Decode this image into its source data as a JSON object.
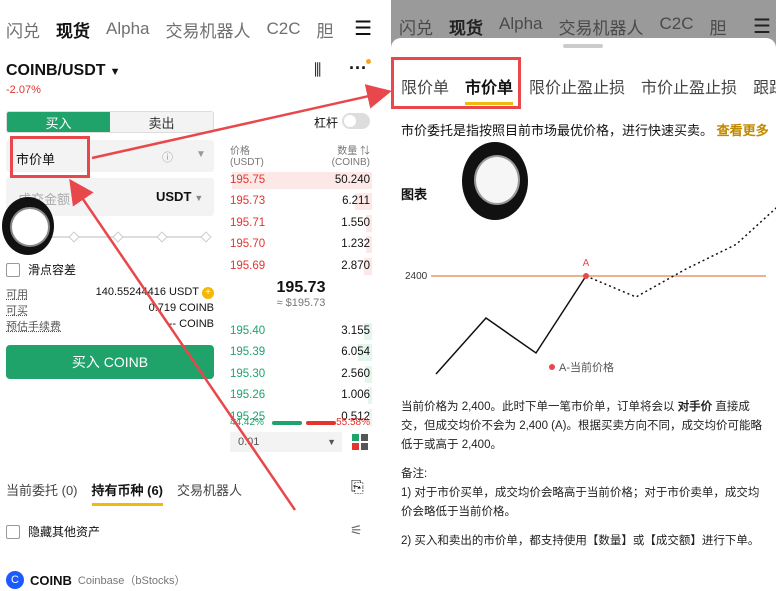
{
  "colors": {
    "buy_green": "#1fa36b",
    "sell_red": "#e3342f",
    "accent_yellow": "#f0b90b",
    "annotation_red": "#e8474b"
  },
  "nav": {
    "items": [
      "闪兑",
      "现货",
      "Alpha",
      "交易机器人",
      "C2C",
      "胆"
    ],
    "active": "现货",
    "menu_icon": "hamburger-icon"
  },
  "pair": {
    "symbol": "COINB/USDT",
    "change": "-2.07%"
  },
  "trade": {
    "buy_tab": "买入",
    "sell_tab": "卖出",
    "leverage_label": "杠杆",
    "order_type": "市价单",
    "amount_placeholder": "成交金额",
    "amount_unit": "USDT",
    "slippage_label": "滑点容差",
    "available_label": "可用",
    "available_value": "140.55244416 USDT",
    "can_buy_label": "可买",
    "can_buy_value": "0.719 COINB",
    "fee_label": "预估手续费",
    "fee_value": "-- COINB",
    "buy_button": "买入 COINB"
  },
  "orderbook": {
    "price_header": "价格\n(USDT)",
    "qty_header": "数量 ⇅\n(COINB)",
    "asks": [
      {
        "price": "195.75",
        "qty": "50.240",
        "depth": 1.0
      },
      {
        "price": "195.73",
        "qty": "6.211",
        "depth": 0.12
      },
      {
        "price": "195.71",
        "qty": "1.550",
        "depth": 0.04
      },
      {
        "price": "195.70",
        "qty": "1.232",
        "depth": 0.04
      },
      {
        "price": "195.69",
        "qty": "2.870",
        "depth": 0.06
      }
    ],
    "mid_price": "195.73",
    "mid_usd": "≈ $195.73",
    "bids": [
      {
        "price": "195.40",
        "qty": "3.155",
        "depth": 0.06
      },
      {
        "price": "195.39",
        "qty": "6.054",
        "depth": 0.1
      },
      {
        "price": "195.30",
        "qty": "2.560",
        "depth": 0.05
      },
      {
        "price": "195.26",
        "qty": "1.006",
        "depth": 0.03
      },
      {
        "price": "195.25",
        "qty": "0.512",
        "depth": 0.02
      }
    ],
    "buy_ratio": "44.42%",
    "sell_ratio": "55.58%",
    "precision": "0.01"
  },
  "bottom_tabs": {
    "items": [
      "当前委托 (0)",
      "持有币种 (6)",
      "交易机器人"
    ],
    "active": "持有币种 (6)"
  },
  "hide_assets_label": "隐藏其他资产",
  "asset": {
    "symbol": "COINB",
    "name": "Coinbase（bStocks）"
  },
  "sheet": {
    "tabs": [
      "限价单",
      "市价单",
      "限价止盈止损",
      "市价止盈止损",
      "跟踪"
    ],
    "active_tab": "市价单",
    "description": "市价委托是指按照目前市场最优价格，进行快速买卖。",
    "learn_more": "查看更多",
    "chart_heading": "图表",
    "notes": {
      "p1a": "当前价格为 2,400。此时下单一笔市价单，订单将会以",
      "p1b": "对手价",
      "p1c": "直接成交，但成交均价不会为 2,400 (A)。根据买卖方向不同，成交均价可能略低于或高于 2,400。",
      "remark": "备注:",
      "n1": "1) 对于市价买单，成交均价会略高于当前价格；对于市价卖单，成交均价会略低于当前价格。",
      "n2": "2) 买入和卖出的市价单，都支持使用【数量】或【成交额】进行下单。"
    }
  },
  "chart_data": {
    "type": "line",
    "title": "",
    "hline": {
      "value": 2400,
      "label": "2400"
    },
    "point_label": "A",
    "legend": "A-当前价格",
    "solid_x": [
      0,
      1,
      2,
      3
    ],
    "solid_y": [
      2260,
      2340,
      2290,
      2400
    ],
    "dotted_x": [
      3,
      4,
      5,
      6,
      7
    ],
    "dotted_y": [
      2400,
      2370,
      2410,
      2445,
      2510
    ]
  }
}
